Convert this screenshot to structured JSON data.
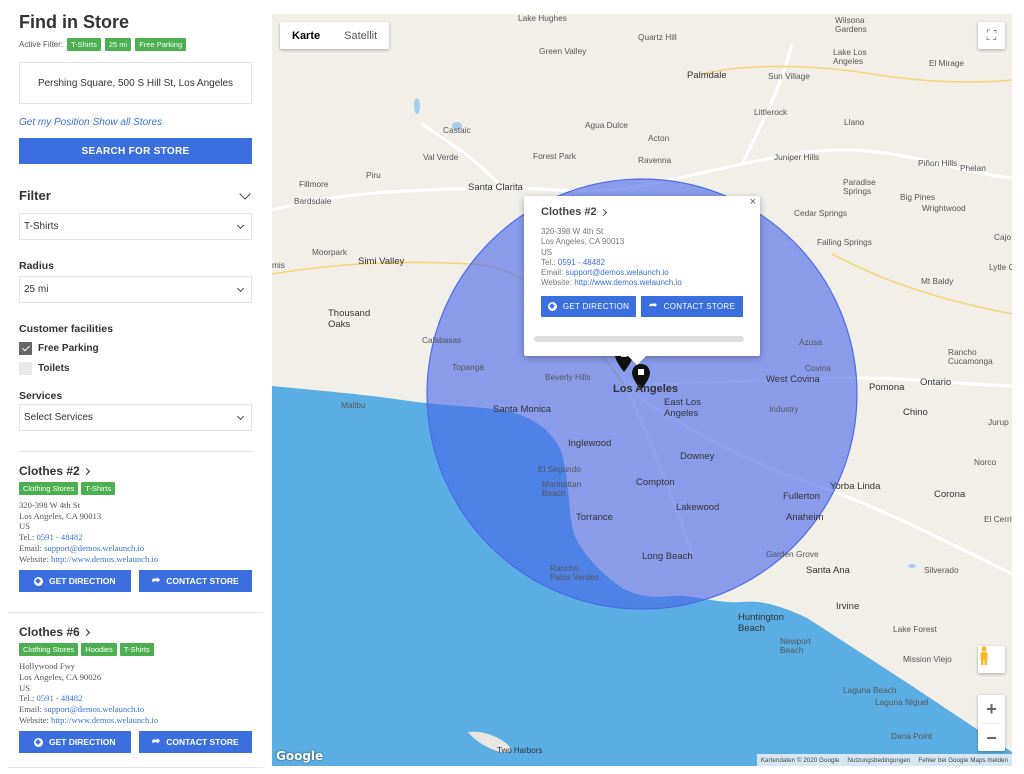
{
  "sidebar": {
    "title": "Find in Store",
    "active_filter_label": "Active Filter:",
    "active_filters": [
      "T-Shirts",
      "25 mi",
      "Free Parking"
    ],
    "address_value": "Pershing Square, 500 S Hill St, Los Angeles",
    "get_position_label": "Get my Position",
    "show_all_label": "Show all Stores",
    "search_button_label": "SEARCH FOR STORE",
    "filter_heading": "Filter",
    "category_selected": "T-Shirts",
    "radius_label": "Radius",
    "radius_selected": "25 mi",
    "facilities_label": "Customer facilities",
    "facilities": [
      {
        "label": "Free Parking",
        "checked": true
      },
      {
        "label": "Toilets",
        "checked": false
      }
    ],
    "services_label": "Services",
    "services_placeholder": "Select Services"
  },
  "stores": [
    {
      "name": "Clothes #2",
      "tags": [
        "Clothing Stores",
        "T-Shirts"
      ],
      "street": "320-398 W 4th St",
      "city": "Los Angeles, CA 90013",
      "country": "US",
      "tel_label": "Tel.:",
      "tel": "0591 - 48482",
      "email_label": "Email:",
      "email": "support@demos.welaunch.io",
      "website_label": "Website:",
      "website": "http://www.demos.welaunch.io",
      "direction_label": "GET DIRECTION",
      "contact_label": "CONTACT STORE"
    },
    {
      "name": "Clothes #6",
      "tags": [
        "Clothing Stores",
        "Hoodies",
        "T-Shirts"
      ],
      "street": "Hollywood Fwy",
      "city": "Los Angeles, CA 90026",
      "country": "US",
      "tel_label": "Tel.:",
      "tel": "0591 - 48482",
      "email_label": "Email:",
      "email": "support@demos.welaunch.io",
      "website_label": "Website:",
      "website": "http://www.demos.welaunch.io",
      "direction_label": "GET DIRECTION",
      "contact_label": "CONTACT STORE"
    }
  ],
  "map": {
    "type_map_label": "Karte",
    "type_satellite_label": "Satellit",
    "zoom_in": "+",
    "zoom_out": "−",
    "google_logo": "Google",
    "attribution": [
      "Kartendaten © 2020 Google",
      "Nutzungsbedingungen",
      "Fehler bei Google Maps melden"
    ],
    "popup": {
      "name": "Clothes #2",
      "street": "320-398 W 4th St",
      "city": "Los Angeles, CA 90013",
      "country": "US",
      "tel_label": "Tel.:",
      "tel": "0591 - 48482",
      "email_label": "Email:",
      "email": "support@demos.welaunch.io",
      "website_label": "Website:",
      "website": "http://www.demos.welaunch.io",
      "direction_label": "GET DIRECTION",
      "contact_label": "CONTACT STORE",
      "close": "×"
    },
    "places": {
      "lake_hughes": "Lake Hughes",
      "quartz_hill": "Quartz Hill",
      "wilsona": "Wilsona\nGardens",
      "green_valley": "Green Valley",
      "lake_los_angeles": "Lake Los\nAngeles",
      "palmdale": "Palmdale",
      "sun_village": "Sun Village",
      "el_mirage": "El Mirage",
      "littlerock": "Littlerock",
      "llano": "Llano",
      "castaic": "Castaic",
      "agua_dulce": "Agua Dulce",
      "acton": "Acton",
      "val_verde": "Val Verde",
      "forest_park": "Forest Park",
      "ravenna": "Ravenna",
      "juniper_hills": "Juniper Hills",
      "pinon_hills": "Piñon Hills",
      "phelan": "Phelan",
      "piru": "Piru",
      "fillmore": "Fillmore",
      "santa_clarita": "Santa Clarita",
      "paradise_springs": "Paradise\nSprings",
      "bardsdale": "Bardsdale",
      "big_pines": "Big Pines",
      "wrightwood": "Wrightwood",
      "cedar_springs": "Cedar Springs",
      "falling_springs": "Falling Springs",
      "moorpark": "Moorpark",
      "simi_valley": "Simi Valley",
      "mis": "mis",
      "lytle_creek": "Lytle C",
      "cajo": "Cajo",
      "mt_baldy": "Mt Baldy",
      "thousand_oaks": "Thousand\nOaks",
      "calabasas": "Calabasas",
      "azusa": "Azusa",
      "rancho_cucamonga": "Rancho\nCucamonga",
      "topanga": "Topanga",
      "beverly_hills": "Beverly Hills",
      "los_angeles": "Los Angeles",
      "west_covina": "West Covina",
      "covina": "Covina",
      "pomona": "Pomona",
      "ontario": "Ontario",
      "malibu": "Malibu",
      "santa_monica": "Santa Monica",
      "east_la": "East Los\nAngeles",
      "industry": "Industry",
      "chino": "Chino",
      "jurupa": "Jurup",
      "inglewood": "Inglewood",
      "downey": "Downey",
      "norco": "Norco",
      "el_segundo": "El Segundo",
      "manhattan_beach": "Manhattan\nBeach",
      "compton": "Compton",
      "yorba_linda": "Yorba Linda",
      "corona": "Corona",
      "torrance": "Torrance",
      "lakewood": "Lakewood",
      "fullerton": "Fullerton",
      "anaheim": "Anaheim",
      "el_cerrito": "El Cerrit",
      "rancho_palos_verdes": "Rancho\nPalos Verdes",
      "long_beach": "Long Beach",
      "garden_grove": "Garden Grove",
      "santa_ana": "Santa Ana",
      "silverado": "Silverado",
      "irvine": "Irvine",
      "huntington_beach": "Huntington\nBeach",
      "lake_forest": "Lake Forest",
      "newport_beach": "Newport\nBeach",
      "mission_viejo": "Mission Viejo",
      "laguna_beach": "Laguna Beach",
      "laguna_niguel": "Laguna Niguel",
      "dana_point": "Dana Point",
      "two_harbors": "Two Harbors"
    }
  }
}
